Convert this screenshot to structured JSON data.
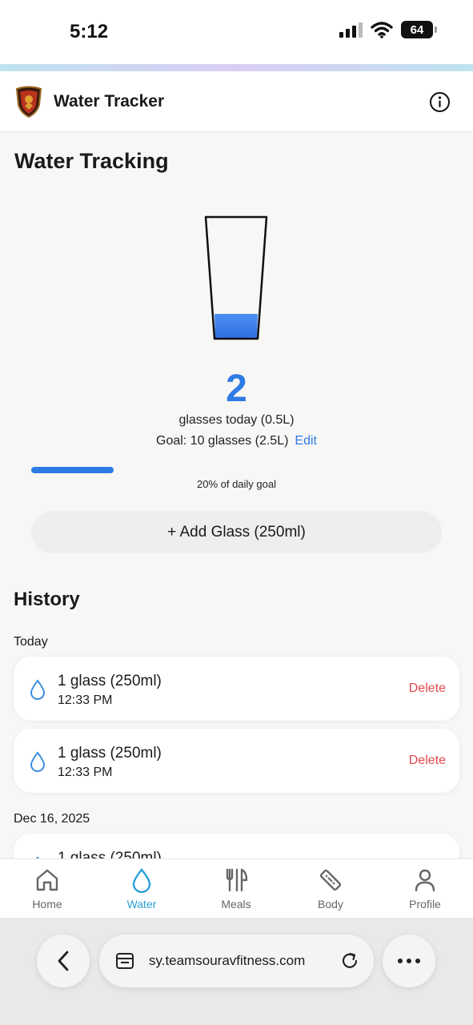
{
  "status": {
    "time": "5:12",
    "battery": "64"
  },
  "header": {
    "title": "Water Tracker"
  },
  "page": {
    "title": "Water Tracking"
  },
  "tracker": {
    "count": "2",
    "glasses_today": "glasses today (0.5L)",
    "goal_text": "Goal: 10 glasses (2.5L)",
    "edit_label": "Edit",
    "progress_fraction": 0.2,
    "percent_text": "20% of daily goal",
    "add_button": "+ Add Glass (250ml)"
  },
  "history": {
    "title": "History",
    "groups": [
      {
        "label": "Today",
        "entries": [
          {
            "amount": "1 glass (250ml)",
            "time": "12:33 PM",
            "delete_label": "Delete"
          },
          {
            "amount": "1 glass (250ml)",
            "time": "12:33 PM",
            "delete_label": "Delete"
          }
        ]
      },
      {
        "label": "Dec 16, 2025",
        "entries": [
          {
            "amount": "1 glass (250ml)"
          }
        ]
      }
    ]
  },
  "nav": {
    "items": [
      {
        "label": "Home",
        "icon": "home-icon"
      },
      {
        "label": "Water",
        "icon": "water-drop-icon",
        "active": true
      },
      {
        "label": "Meals",
        "icon": "fork-knife-icon"
      },
      {
        "label": "Body",
        "icon": "ruler-icon"
      },
      {
        "label": "Profile",
        "icon": "person-icon"
      }
    ]
  },
  "browser": {
    "url": "sy.teamsouravfitness.com"
  },
  "colors": {
    "accent": "#2f7be6",
    "water_tab": "#2a9fd8",
    "delete": "#e5484d"
  }
}
